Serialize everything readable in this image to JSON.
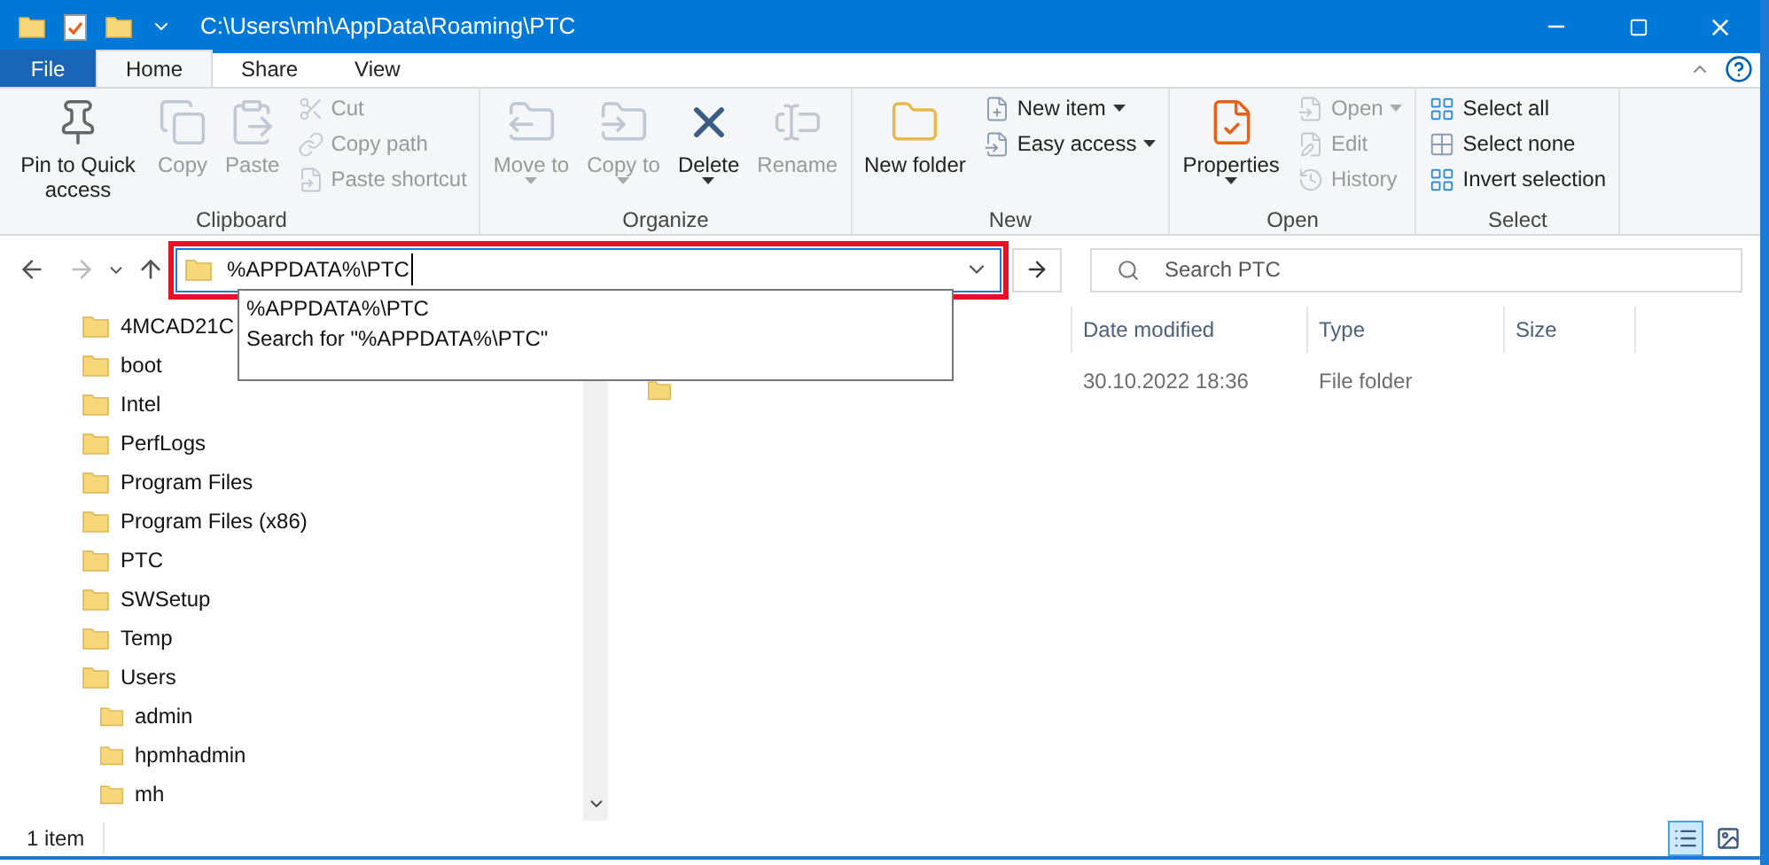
{
  "window": {
    "title": "C:\\Users\\mh\\AppData\\Roaming\\PTC"
  },
  "tabs": [
    {
      "label": "File",
      "kind": "file",
      "selected": false
    },
    {
      "label": "Home",
      "kind": "tab",
      "selected": true
    },
    {
      "label": "Share",
      "kind": "tab",
      "selected": false
    },
    {
      "label": "View",
      "kind": "tab",
      "selected": false
    }
  ],
  "ribbon_groups": [
    {
      "label": "Clipboard",
      "items": [
        {
          "kind": "large",
          "label": "Pin to Quick access",
          "disabled": false,
          "dropdown": false
        },
        {
          "kind": "large",
          "label": "Copy",
          "disabled": true,
          "dropdown": false
        },
        {
          "kind": "large",
          "label": "Paste",
          "disabled": true,
          "dropdown": false
        },
        {
          "kind": "stack",
          "items": [
            {
              "label": "Cut",
              "disabled": true,
              "dropdown": false
            },
            {
              "label": "Copy path",
              "disabled": true,
              "dropdown": false
            },
            {
              "label": "Paste shortcut",
              "disabled": true,
              "dropdown": false
            }
          ]
        }
      ]
    },
    {
      "label": "Organize",
      "items": [
        {
          "kind": "large",
          "label": "Move to",
          "disabled": true,
          "dropdown": true
        },
        {
          "kind": "large",
          "label": "Copy to",
          "disabled": true,
          "dropdown": true
        },
        {
          "kind": "large",
          "label": "Delete",
          "disabled": false,
          "dropdown": true
        },
        {
          "kind": "large",
          "label": "Rename",
          "disabled": true,
          "dropdown": false
        }
      ]
    },
    {
      "label": "New",
      "items": [
        {
          "kind": "large",
          "label": "New folder",
          "disabled": false,
          "dropdown": false
        },
        {
          "kind": "stack",
          "items": [
            {
              "label": "New item",
              "disabled": false,
              "dropdown": true
            },
            {
              "label": "Easy access",
              "disabled": false,
              "dropdown": true
            }
          ]
        }
      ]
    },
    {
      "label": "Open",
      "items": [
        {
          "kind": "large",
          "label": "Properties",
          "disabled": false,
          "dropdown": true
        },
        {
          "kind": "stack",
          "items": [
            {
              "label": "Open",
              "disabled": true,
              "dropdown": true
            },
            {
              "label": "Edit",
              "disabled": true,
              "dropdown": false
            },
            {
              "label": "History",
              "disabled": true,
              "dropdown": false
            }
          ]
        }
      ]
    },
    {
      "label": "Select",
      "items": [
        {
          "kind": "stack",
          "items": [
            {
              "label": "Select all",
              "disabled": false,
              "dropdown": false
            },
            {
              "label": "Select none",
              "disabled": false,
              "dropdown": false
            },
            {
              "label": "Invert selection",
              "disabled": false,
              "dropdown": false
            }
          ]
        }
      ]
    }
  ],
  "address_bar": {
    "value": "%APPDATA%\\PTC",
    "highlighted": true
  },
  "address_suggestions": [
    "%APPDATA%\\PTC",
    "Search for \"%APPDATA%\\PTC\""
  ],
  "search": {
    "placeholder": "Search PTC"
  },
  "nav_tree": [
    {
      "label": "4MCAD21C"
    },
    {
      "label": "boot"
    },
    {
      "label": "Intel"
    },
    {
      "label": "PerfLogs"
    },
    {
      "label": "Program Files"
    },
    {
      "label": "Program Files (x86)"
    },
    {
      "label": "PTC"
    },
    {
      "label": "SWSetup"
    },
    {
      "label": "Temp"
    },
    {
      "label": "Users",
      "children": [
        {
          "label": "admin"
        },
        {
          "label": "hpmhadmin"
        },
        {
          "label": "mh"
        }
      ]
    }
  ],
  "file_list": {
    "columns": [
      "Date modified",
      "Type",
      "Size"
    ],
    "rows": [
      {
        "date_modified": "30.10.2022 18:36",
        "type": "File folder"
      }
    ]
  },
  "status_bar": {
    "item_count": "1 item",
    "views": [
      {
        "kind": "details",
        "selected": true
      },
      {
        "kind": "tiles",
        "selected": false
      }
    ]
  }
}
